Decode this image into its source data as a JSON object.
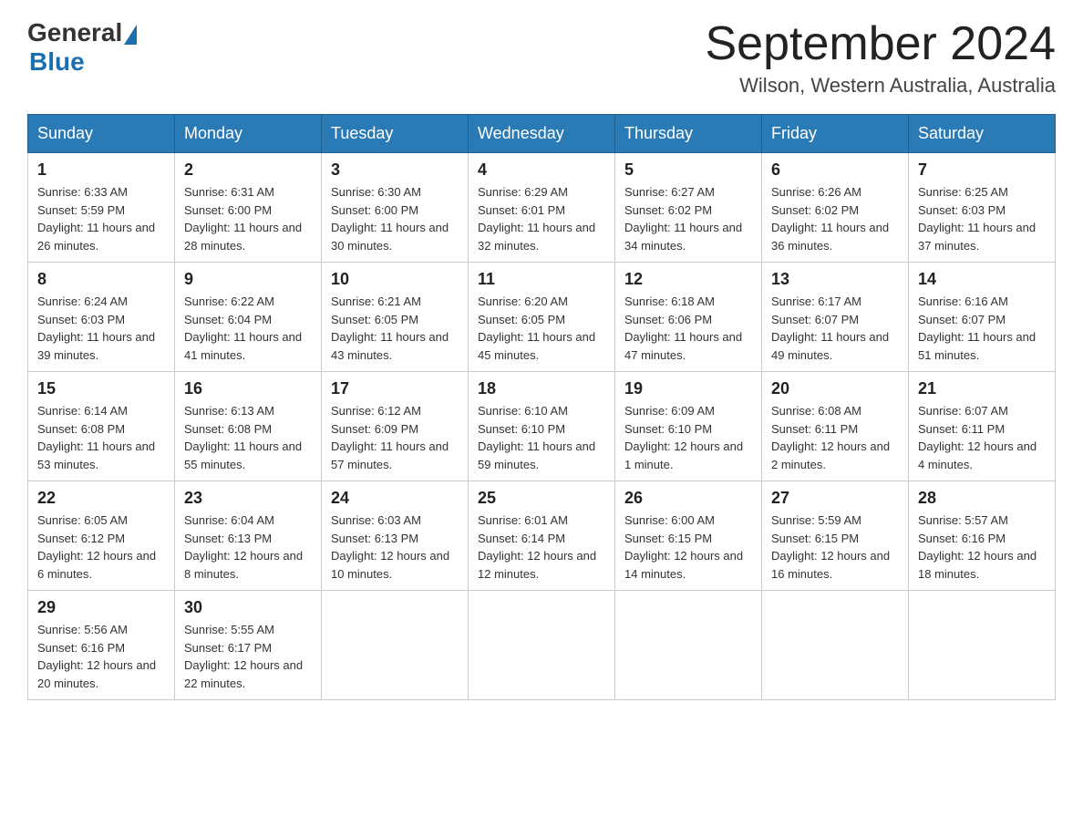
{
  "header": {
    "logo_general": "General",
    "logo_blue": "Blue",
    "title": "September 2024",
    "location": "Wilson, Western Australia, Australia"
  },
  "days_of_week": [
    "Sunday",
    "Monday",
    "Tuesday",
    "Wednesday",
    "Thursday",
    "Friday",
    "Saturday"
  ],
  "weeks": [
    [
      {
        "day": "1",
        "sunrise": "6:33 AM",
        "sunset": "5:59 PM",
        "daylight": "11 hours and 26 minutes."
      },
      {
        "day": "2",
        "sunrise": "6:31 AM",
        "sunset": "6:00 PM",
        "daylight": "11 hours and 28 minutes."
      },
      {
        "day": "3",
        "sunrise": "6:30 AM",
        "sunset": "6:00 PM",
        "daylight": "11 hours and 30 minutes."
      },
      {
        "day": "4",
        "sunrise": "6:29 AM",
        "sunset": "6:01 PM",
        "daylight": "11 hours and 32 minutes."
      },
      {
        "day": "5",
        "sunrise": "6:27 AM",
        "sunset": "6:02 PM",
        "daylight": "11 hours and 34 minutes."
      },
      {
        "day": "6",
        "sunrise": "6:26 AM",
        "sunset": "6:02 PM",
        "daylight": "11 hours and 36 minutes."
      },
      {
        "day": "7",
        "sunrise": "6:25 AM",
        "sunset": "6:03 PM",
        "daylight": "11 hours and 37 minutes."
      }
    ],
    [
      {
        "day": "8",
        "sunrise": "6:24 AM",
        "sunset": "6:03 PM",
        "daylight": "11 hours and 39 minutes."
      },
      {
        "day": "9",
        "sunrise": "6:22 AM",
        "sunset": "6:04 PM",
        "daylight": "11 hours and 41 minutes."
      },
      {
        "day": "10",
        "sunrise": "6:21 AM",
        "sunset": "6:05 PM",
        "daylight": "11 hours and 43 minutes."
      },
      {
        "day": "11",
        "sunrise": "6:20 AM",
        "sunset": "6:05 PM",
        "daylight": "11 hours and 45 minutes."
      },
      {
        "day": "12",
        "sunrise": "6:18 AM",
        "sunset": "6:06 PM",
        "daylight": "11 hours and 47 minutes."
      },
      {
        "day": "13",
        "sunrise": "6:17 AM",
        "sunset": "6:07 PM",
        "daylight": "11 hours and 49 minutes."
      },
      {
        "day": "14",
        "sunrise": "6:16 AM",
        "sunset": "6:07 PM",
        "daylight": "11 hours and 51 minutes."
      }
    ],
    [
      {
        "day": "15",
        "sunrise": "6:14 AM",
        "sunset": "6:08 PM",
        "daylight": "11 hours and 53 minutes."
      },
      {
        "day": "16",
        "sunrise": "6:13 AM",
        "sunset": "6:08 PM",
        "daylight": "11 hours and 55 minutes."
      },
      {
        "day": "17",
        "sunrise": "6:12 AM",
        "sunset": "6:09 PM",
        "daylight": "11 hours and 57 minutes."
      },
      {
        "day": "18",
        "sunrise": "6:10 AM",
        "sunset": "6:10 PM",
        "daylight": "11 hours and 59 minutes."
      },
      {
        "day": "19",
        "sunrise": "6:09 AM",
        "sunset": "6:10 PM",
        "daylight": "12 hours and 1 minute."
      },
      {
        "day": "20",
        "sunrise": "6:08 AM",
        "sunset": "6:11 PM",
        "daylight": "12 hours and 2 minutes."
      },
      {
        "day": "21",
        "sunrise": "6:07 AM",
        "sunset": "6:11 PM",
        "daylight": "12 hours and 4 minutes."
      }
    ],
    [
      {
        "day": "22",
        "sunrise": "6:05 AM",
        "sunset": "6:12 PM",
        "daylight": "12 hours and 6 minutes."
      },
      {
        "day": "23",
        "sunrise": "6:04 AM",
        "sunset": "6:13 PM",
        "daylight": "12 hours and 8 minutes."
      },
      {
        "day": "24",
        "sunrise": "6:03 AM",
        "sunset": "6:13 PM",
        "daylight": "12 hours and 10 minutes."
      },
      {
        "day": "25",
        "sunrise": "6:01 AM",
        "sunset": "6:14 PM",
        "daylight": "12 hours and 12 minutes."
      },
      {
        "day": "26",
        "sunrise": "6:00 AM",
        "sunset": "6:15 PM",
        "daylight": "12 hours and 14 minutes."
      },
      {
        "day": "27",
        "sunrise": "5:59 AM",
        "sunset": "6:15 PM",
        "daylight": "12 hours and 16 minutes."
      },
      {
        "day": "28",
        "sunrise": "5:57 AM",
        "sunset": "6:16 PM",
        "daylight": "12 hours and 18 minutes."
      }
    ],
    [
      {
        "day": "29",
        "sunrise": "5:56 AM",
        "sunset": "6:16 PM",
        "daylight": "12 hours and 20 minutes."
      },
      {
        "day": "30",
        "sunrise": "5:55 AM",
        "sunset": "6:17 PM",
        "daylight": "12 hours and 22 minutes."
      },
      null,
      null,
      null,
      null,
      null
    ]
  ],
  "labels": {
    "sunrise": "Sunrise:",
    "sunset": "Sunset:",
    "daylight": "Daylight:"
  }
}
